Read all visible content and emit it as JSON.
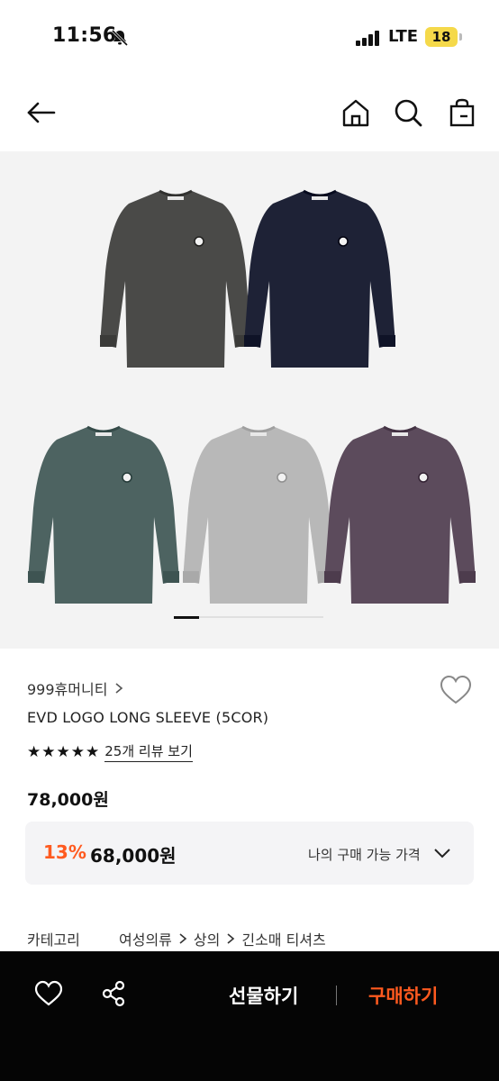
{
  "status_bar": {
    "time": "11:56",
    "network": "LTE",
    "battery": "18"
  },
  "header": {
    "back": "back-arrow-icon",
    "home": "home-icon",
    "search": "search-icon",
    "bag": "shopping-bag-icon"
  },
  "gallery": {
    "items": [
      "charcoal",
      "navy",
      "green",
      "gray",
      "purple"
    ],
    "colors": {
      "charcoal": "#4a4a48",
      "navy": "#1e2236",
      "green": "#4d6361",
      "gray": "#b8b8b8",
      "purple": "#5c4b5c"
    },
    "background": "#f3f3f3",
    "page": 1,
    "page_count": 6
  },
  "product": {
    "brand": "999휴머니티",
    "name": "EVD LOGO LONG SLEEVE (5COR)",
    "rating_stars": 5,
    "review_link": "25개 리뷰 보기",
    "original_price": "78,000원",
    "discount_rate": "13%",
    "sale_price": "68,000원",
    "my_price_label": "나의 구매 가능 가격"
  },
  "category": {
    "label": "카테고리",
    "path": [
      "여성의류",
      "상의",
      "긴소매 티셔츠"
    ]
  },
  "bottom_bar": {
    "gift_label": "선물하기",
    "buy_label": "구매하기",
    "accent_color": "#ff5a1f"
  }
}
